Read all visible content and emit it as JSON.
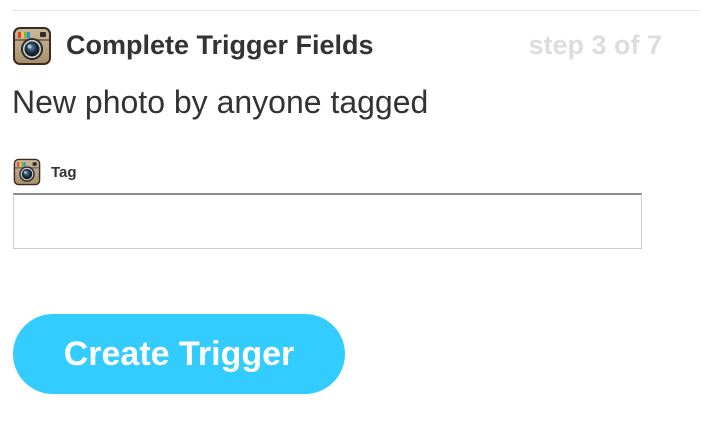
{
  "header": {
    "title": "Complete Trigger Fields",
    "step": "step 3 of 7",
    "icon": "instagram-icon"
  },
  "trigger": {
    "description": "New photo by anyone tagged"
  },
  "field": {
    "label": "Tag",
    "icon": "instagram-icon",
    "value": ""
  },
  "actions": {
    "create_label": "Create Trigger"
  },
  "colors": {
    "button_bg": "#33ccff",
    "step_text": "#dddddd",
    "title_text": "#333333"
  }
}
